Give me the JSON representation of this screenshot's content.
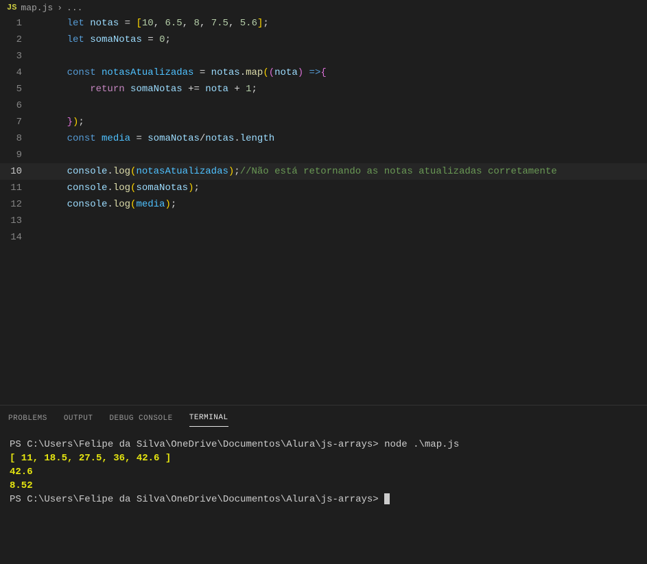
{
  "breadcrumb": {
    "icon": "JS",
    "filename": "map.js",
    "separator": "›",
    "trail": "..."
  },
  "code": {
    "lines": [
      {
        "num": "1",
        "indent": "    ",
        "tokens": [
          [
            "keyword",
            "let"
          ],
          [
            "text",
            " "
          ],
          [
            "var",
            "notas"
          ],
          [
            "text",
            " "
          ],
          [
            "operator",
            "="
          ],
          [
            "text",
            " "
          ],
          [
            "bracket",
            "["
          ],
          [
            "number",
            "10"
          ],
          [
            "punct",
            ","
          ],
          [
            "text",
            " "
          ],
          [
            "number",
            "6.5"
          ],
          [
            "punct",
            ","
          ],
          [
            "text",
            " "
          ],
          [
            "number",
            "8"
          ],
          [
            "punct",
            ","
          ],
          [
            "text",
            " "
          ],
          [
            "number",
            "7.5"
          ],
          [
            "punct",
            ","
          ],
          [
            "text",
            " "
          ],
          [
            "number",
            "5.6"
          ],
          [
            "bracket",
            "]"
          ],
          [
            "punct",
            ";"
          ]
        ]
      },
      {
        "num": "2",
        "indent": "    ",
        "tokens": [
          [
            "keyword",
            "let"
          ],
          [
            "text",
            " "
          ],
          [
            "var",
            "somaNotas"
          ],
          [
            "text",
            " "
          ],
          [
            "operator",
            "="
          ],
          [
            "text",
            " "
          ],
          [
            "number",
            "0"
          ],
          [
            "punct",
            ";"
          ]
        ]
      },
      {
        "num": "3",
        "indent": "",
        "tokens": []
      },
      {
        "num": "4",
        "indent": "    ",
        "tokens": [
          [
            "const",
            "const"
          ],
          [
            "text",
            " "
          ],
          [
            "readonly",
            "notasAtualizadas"
          ],
          [
            "text",
            " "
          ],
          [
            "operator",
            "="
          ],
          [
            "text",
            " "
          ],
          [
            "var",
            "notas"
          ],
          [
            "punct",
            "."
          ],
          [
            "func",
            "map"
          ],
          [
            "paren1",
            "("
          ],
          [
            "paren2",
            "("
          ],
          [
            "param",
            "nota"
          ],
          [
            "paren2",
            ")"
          ],
          [
            "text",
            " "
          ],
          [
            "const",
            "=>"
          ],
          [
            "paren2",
            "{"
          ]
        ]
      },
      {
        "num": "5",
        "indent": "        ",
        "tokens": [
          [
            "return",
            "return"
          ],
          [
            "text",
            " "
          ],
          [
            "var",
            "somaNotas"
          ],
          [
            "text",
            " "
          ],
          [
            "operator",
            "+="
          ],
          [
            "text",
            " "
          ],
          [
            "var",
            "nota"
          ],
          [
            "text",
            " "
          ],
          [
            "operator",
            "+"
          ],
          [
            "text",
            " "
          ],
          [
            "number",
            "1"
          ],
          [
            "punct",
            ";"
          ]
        ]
      },
      {
        "num": "6",
        "indent": "",
        "tokens": []
      },
      {
        "num": "7",
        "indent": "    ",
        "tokens": [
          [
            "paren2",
            "}"
          ],
          [
            "paren1",
            ")"
          ],
          [
            "punct",
            ";"
          ]
        ]
      },
      {
        "num": "8",
        "indent": "    ",
        "tokens": [
          [
            "const",
            "const"
          ],
          [
            "text",
            " "
          ],
          [
            "readonly",
            "media"
          ],
          [
            "text",
            " "
          ],
          [
            "operator",
            "="
          ],
          [
            "text",
            " "
          ],
          [
            "var",
            "somaNotas"
          ],
          [
            "operator",
            "/"
          ],
          [
            "var",
            "notas"
          ],
          [
            "punct",
            "."
          ],
          [
            "prop",
            "length"
          ]
        ]
      },
      {
        "num": "9",
        "indent": "",
        "tokens": []
      },
      {
        "num": "10",
        "indent": "    ",
        "active": true,
        "tokens": [
          [
            "var",
            "console"
          ],
          [
            "punct",
            "."
          ],
          [
            "func",
            "log"
          ],
          [
            "paren1",
            "("
          ],
          [
            "readonly",
            "notasAtualizadas"
          ],
          [
            "paren1",
            ")"
          ],
          [
            "punct",
            ";"
          ],
          [
            "comment",
            "//Não está retornando as notas atualizadas corretamente"
          ]
        ]
      },
      {
        "num": "11",
        "indent": "    ",
        "tokens": [
          [
            "var",
            "console"
          ],
          [
            "punct",
            "."
          ],
          [
            "func",
            "log"
          ],
          [
            "paren1",
            "("
          ],
          [
            "var",
            "somaNotas"
          ],
          [
            "paren1",
            ")"
          ],
          [
            "punct",
            ";"
          ]
        ]
      },
      {
        "num": "12",
        "indent": "    ",
        "tokens": [
          [
            "var",
            "console"
          ],
          [
            "punct",
            "."
          ],
          [
            "func",
            "log"
          ],
          [
            "paren1",
            "("
          ],
          [
            "readonly",
            "media"
          ],
          [
            "paren1",
            ")"
          ],
          [
            "punct",
            ";"
          ]
        ]
      },
      {
        "num": "13",
        "indent": "",
        "tokens": []
      },
      {
        "num": "14",
        "indent": "",
        "tokens": []
      }
    ]
  },
  "panel": {
    "tabs": {
      "problems": "PROBLEMS",
      "output": "OUTPUT",
      "debug": "DEBUG CONSOLE",
      "terminal": "TERMINAL"
    },
    "active": "terminal"
  },
  "terminal": {
    "prompt1_path": "PS C:\\Users\\Felipe da Silva\\OneDrive\\Documentos\\Alura\\js-arrays> ",
    "prompt1_cmd": "node .\\map.js",
    "out_array": "[ 11, 18.5, 27.5, 36, 42.6 ]",
    "out_sum": "42.6",
    "out_avg": "8.52",
    "prompt2_path": "PS C:\\Users\\Felipe da Silva\\OneDrive\\Documentos\\Alura\\js-arrays> "
  }
}
